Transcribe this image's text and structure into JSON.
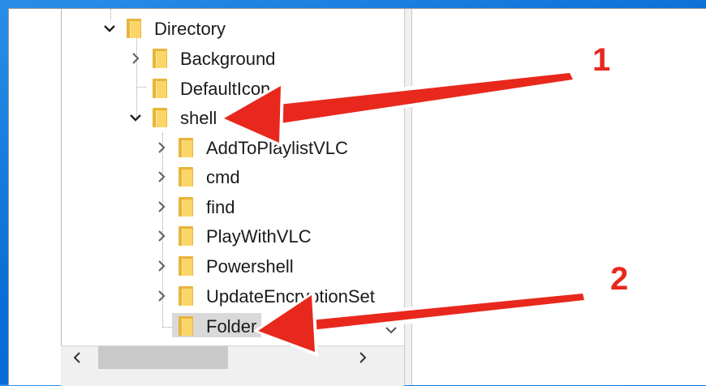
{
  "tree": {
    "nodes": [
      {
        "label": "Directory",
        "toggle": "expanded",
        "level": 0
      },
      {
        "label": "Background",
        "toggle": "collapsed",
        "level": 1
      },
      {
        "label": "DefaultIcon",
        "toggle": "none",
        "level": 1
      },
      {
        "label": "shell",
        "toggle": "expanded",
        "level": 1
      },
      {
        "label": "AddToPlaylistVLC",
        "toggle": "collapsed",
        "level": 2
      },
      {
        "label": "cmd",
        "toggle": "collapsed",
        "level": 2
      },
      {
        "label": "find",
        "toggle": "collapsed",
        "level": 2
      },
      {
        "label": "PlayWithVLC",
        "toggle": "collapsed",
        "level": 2
      },
      {
        "label": "Powershell",
        "toggle": "collapsed",
        "level": 2
      },
      {
        "label": "UpdateEncryptionSet",
        "toggle": "collapsed",
        "level": 2
      },
      {
        "label": "Folder",
        "toggle": "none",
        "level": 2,
        "selected": true
      }
    ]
  },
  "icons": {
    "expanded": "chevron-down-icon",
    "collapsed": "chevron-right-icon",
    "folder": "folder-icon",
    "scroll_left": "chevron-left-icon",
    "scroll_right": "chevron-right-icon",
    "scroll_down": "chevron-down-icon"
  },
  "annotations": {
    "callout_1": "1",
    "callout_2": "2",
    "arrow_color": "#e8281d"
  },
  "colors": {
    "desktop": "#0a6fd6",
    "folder_back": "#e8b43c",
    "folder_front": "#fbd666",
    "selection": "#d9d9d9"
  }
}
